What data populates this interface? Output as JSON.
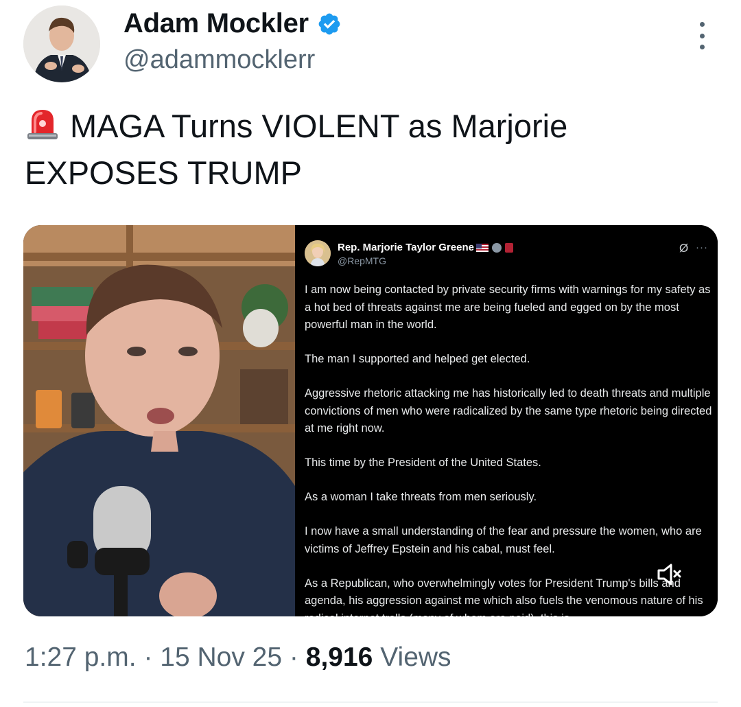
{
  "author": {
    "name": "Adam Mockler",
    "handle": "@adammocklerr",
    "verified": true
  },
  "tweet": {
    "text": "MAGA Turns VIOLENT as Marjorie EXPOSES TRUMP",
    "leading_icon": "police-siren-icon"
  },
  "embedded_post": {
    "name": "Rep. Marjorie Taylor Greene",
    "handle": "@RepMTG",
    "paragraphs": [
      "I am now being contacted by private security firms with warnings for my safety as a hot bed of threats against me are being fueled and egged on by the most powerful man in the world.",
      "The man I supported and helped get elected.",
      "Aggressive rhetoric attacking me has historically led to death threats and multiple convictions of men who were radicalized by the same type rhetoric being directed at me right now.",
      "This time by the President of the United States.",
      "As a woman I take threats from men seriously.",
      "I now have a small understanding of the fear and pressure the women, who are victims of Jeffrey Epstein and his cabal, must feel.",
      "As a Republican, who overwhelmingly votes for President Trump's bills and agenda, his aggression against me which also fuels the venomous nature of his radical internet trolls (many of whom are paid), this is"
    ]
  },
  "meta": {
    "time": "1:27 p.m.",
    "separator": "·",
    "date": "15 Nov 25",
    "views_count": "8,916",
    "views_label": "Views"
  },
  "colors": {
    "text_primary": "#0f1419",
    "text_secondary": "#536471",
    "verified_blue": "#1d9bf0"
  }
}
